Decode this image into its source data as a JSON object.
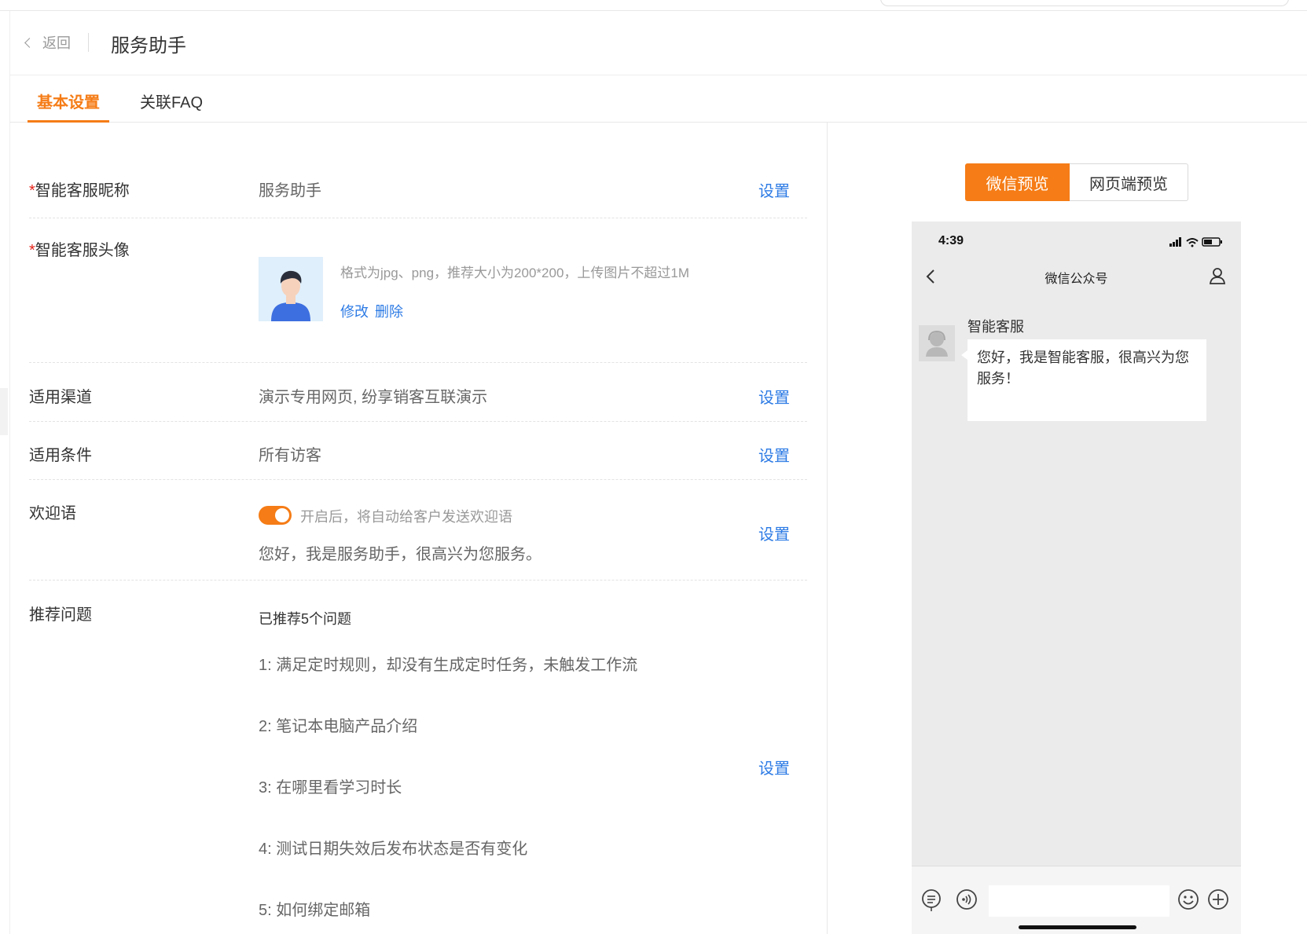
{
  "header": {
    "back_label": "返回",
    "title": "服务助手"
  },
  "tabs": [
    {
      "label": "基本设置",
      "active": true
    },
    {
      "label": "关联FAQ",
      "active": false
    }
  ],
  "settings": {
    "action_label": "设置",
    "nickname": {
      "required_mark": "*",
      "label": "智能客服昵称",
      "value": "服务助手"
    },
    "avatar": {
      "required_mark": "*",
      "label": "智能客服头像",
      "hint": "格式为jpg、png，推荐大小为200*200，上传图片不超过1M",
      "edit_label": "修改",
      "delete_label": "删除"
    },
    "channel": {
      "label": "适用渠道",
      "value": "演示专用网页, 纷享销客互联演示"
    },
    "condition": {
      "label": "适用条件",
      "value": "所有访客"
    },
    "welcome": {
      "label": "欢迎语",
      "enabled": true,
      "toggle_hint": "开启后，将自动给客户发送欢迎语",
      "text": "您好，我是服务助手，很高兴为您服务。"
    },
    "recommended": {
      "label": "推荐问题",
      "summary": "已推荐5个问题",
      "items": [
        "1: 满足定时规则，却没有生成定时任务，未触发工作流",
        "2: 笔记本电脑产品介绍",
        "3: 在哪里看学习时长",
        "4: 测试日期失效后发布状态是否有变化",
        "5: 如何绑定邮箱"
      ]
    }
  },
  "preview": {
    "buttons": [
      {
        "label": "微信预览",
        "active": true
      },
      {
        "label": "网页端预览",
        "active": false
      }
    ],
    "phone": {
      "time": "4:39",
      "nav_title": "微信公众号",
      "bot_name": "智能客服",
      "message": "您好，我是智能客服，很高兴为您服务！"
    }
  },
  "colors": {
    "accent": "#f57c16",
    "link": "#2d7be5",
    "required": "#e5261b"
  }
}
